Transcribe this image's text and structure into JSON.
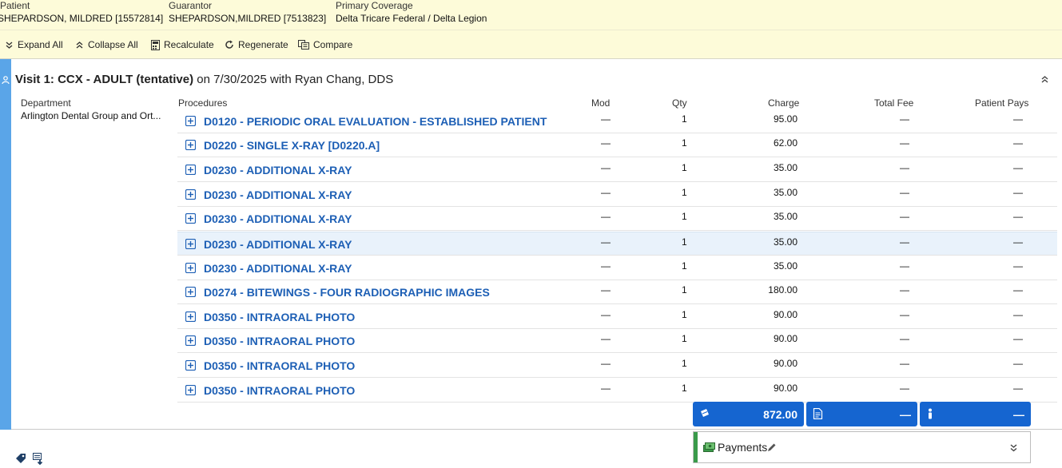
{
  "header": {
    "patient_label": "Patient",
    "patient_value": "SHEPARDSON, MILDRED [15572814]",
    "guarantor_label": "Guarantor",
    "guarantor_value": "SHEPARDSON,MILDRED [7513823]",
    "coverage_label": "Primary Coverage",
    "coverage_value": "Delta Tricare Federal / Delta Legion"
  },
  "toolbar": {
    "expand_all": "Expand All",
    "collapse_all": "Collapse All",
    "recalculate": "Recalculate",
    "regenerate": "Regenerate",
    "compare": "Compare"
  },
  "visit": {
    "title_bold": "Visit 1: CCX - ADULT (tentative)",
    "title_rest": " on 7/30/2025 with Ryan Chang, DDS",
    "department_header": "Department",
    "department_value": "Arlington Dental Group and Ort...",
    "columns": {
      "procedures": "Procedures",
      "mod": "Mod",
      "qty": "Qty",
      "charge": "Charge",
      "total_fee": "Total Fee",
      "patient_pays": "Patient Pays"
    },
    "procedures": [
      {
        "code": "D0120 - PERIODIC ORAL EVALUATION - ESTABLISHED PATIENT",
        "mod": "—",
        "qty": "1",
        "charge": "95.00",
        "total_fee": "—",
        "patient_pays": "—"
      },
      {
        "code": "D0220 - SINGLE X-RAY [D0220.A]",
        "mod": "—",
        "qty": "1",
        "charge": "62.00",
        "total_fee": "—",
        "patient_pays": "—"
      },
      {
        "code": "D0230 - ADDITIONAL X-RAY",
        "mod": "—",
        "qty": "1",
        "charge": "35.00",
        "total_fee": "—",
        "patient_pays": "—"
      },
      {
        "code": "D0230 - ADDITIONAL X-RAY",
        "mod": "—",
        "qty": "1",
        "charge": "35.00",
        "total_fee": "—",
        "patient_pays": "—"
      },
      {
        "code": "D0230 - ADDITIONAL X-RAY",
        "mod": "—",
        "qty": "1",
        "charge": "35.00",
        "total_fee": "—",
        "patient_pays": "—"
      },
      {
        "code": "D0230 - ADDITIONAL X-RAY",
        "mod": "—",
        "qty": "1",
        "charge": "35.00",
        "total_fee": "—",
        "patient_pays": "—"
      },
      {
        "code": "D0230 - ADDITIONAL X-RAY",
        "mod": "—",
        "qty": "1",
        "charge": "35.00",
        "total_fee": "—",
        "patient_pays": "—"
      },
      {
        "code": "D0274 - BITEWINGS - FOUR RADIOGRAPHIC IMAGES",
        "mod": "—",
        "qty": "1",
        "charge": "180.00",
        "total_fee": "—",
        "patient_pays": "—"
      },
      {
        "code": "D0350 - INTRAORAL PHOTO",
        "mod": "—",
        "qty": "1",
        "charge": "90.00",
        "total_fee": "—",
        "patient_pays": "—"
      },
      {
        "code": "D0350 - INTRAORAL PHOTO",
        "mod": "—",
        "qty": "1",
        "charge": "90.00",
        "total_fee": "—",
        "patient_pays": "—"
      },
      {
        "code": "D0350 - INTRAORAL PHOTO",
        "mod": "—",
        "qty": "1",
        "charge": "90.00",
        "total_fee": "—",
        "patient_pays": "—"
      },
      {
        "code": "D0350 - INTRAORAL PHOTO",
        "mod": "—",
        "qty": "1",
        "charge": "90.00",
        "total_fee": "—",
        "patient_pays": "—"
      }
    ],
    "totals": {
      "charge_total": "872.00",
      "total_fee": "—",
      "patient_pays": "—"
    }
  },
  "payments": {
    "label": "Payments"
  },
  "colors": {
    "header_bg": "#fdfbd9",
    "accent_blue": "#1565d0",
    "link_blue": "#1d5fb5",
    "left_bar": "#5aa5e8",
    "payments_stripe": "#3a9a4a"
  }
}
